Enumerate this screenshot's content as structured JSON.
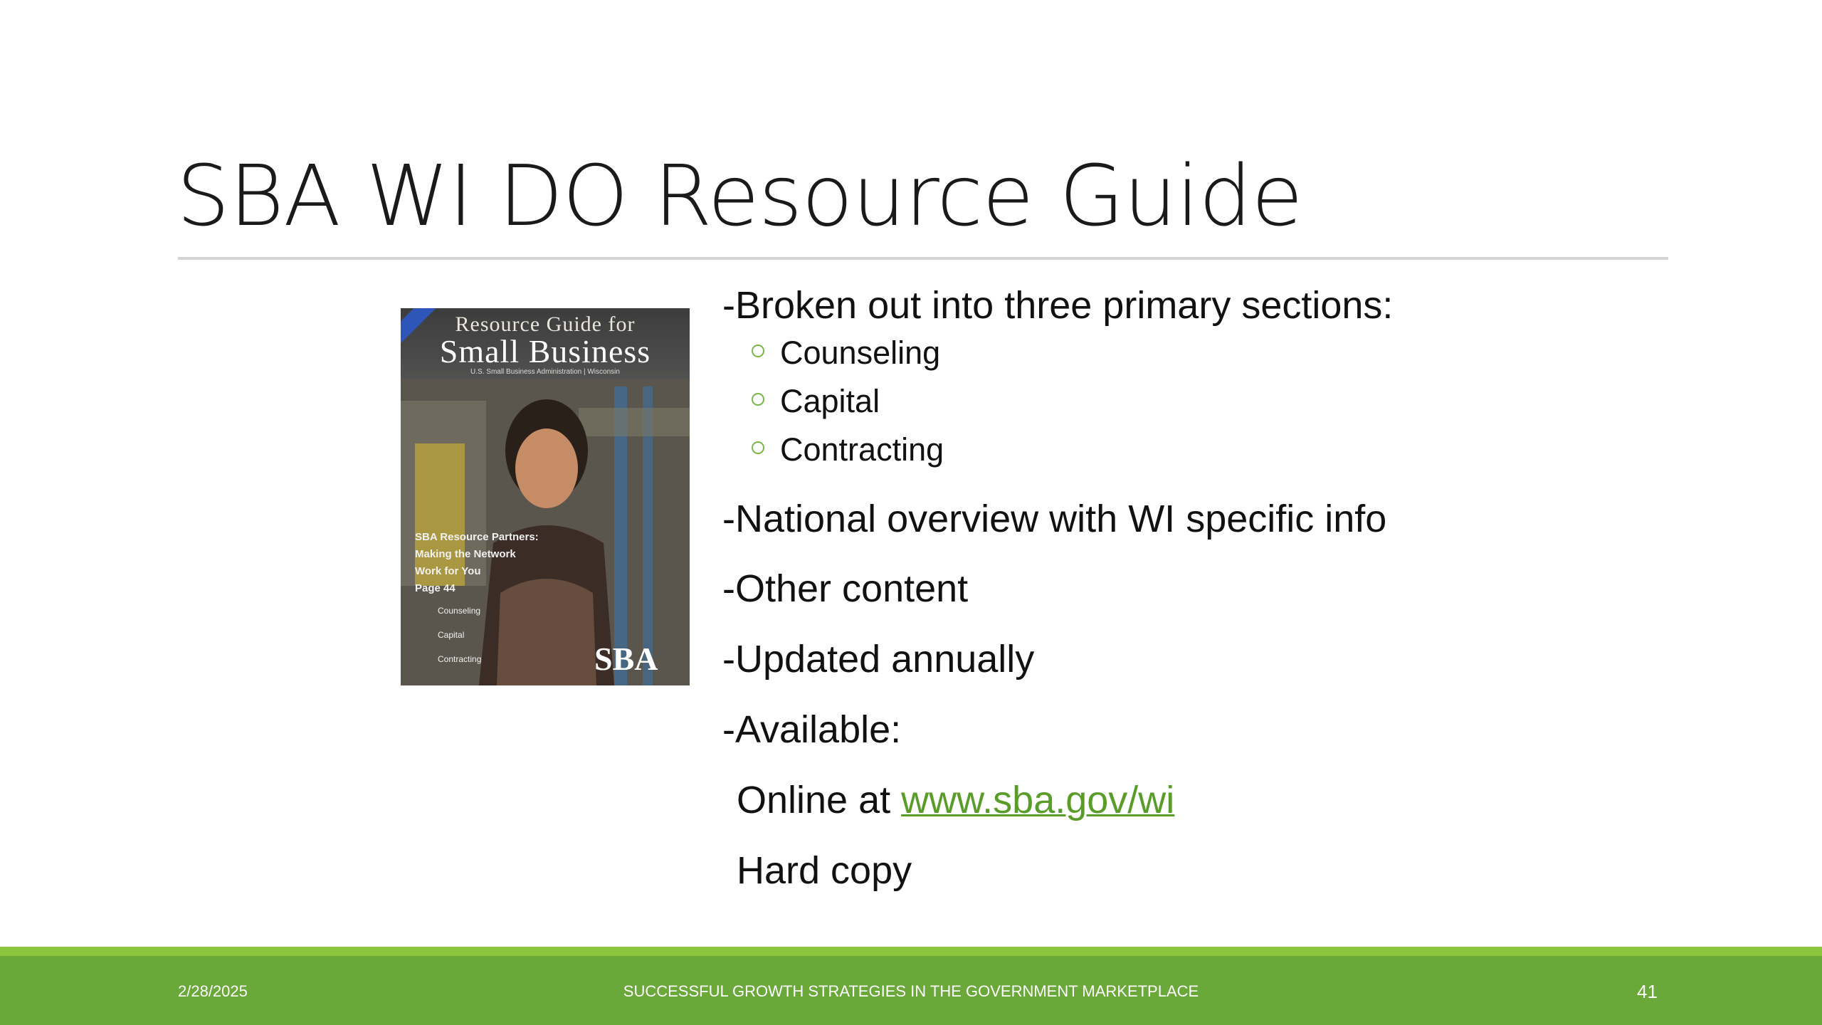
{
  "slide": {
    "title": "SBA WI DO Resource Guide",
    "cover": {
      "line1": "Resource Guide for",
      "line2": "Small Business",
      "line3": "U.S. Small Business Administration | Wisconsin",
      "teaser": [
        "SBA Resource Partners:",
        "Making the Network",
        "Work for You",
        "Page 44"
      ],
      "list": [
        "Counseling",
        "Capital",
        "Contracting"
      ],
      "logo": "SBA"
    },
    "bullets": {
      "p1": "-Broken out into three primary sections:",
      "sub": [
        "Counseling",
        "Capital",
        "Contracting"
      ],
      "p2": "-National overview with WI specific info",
      "p3": "-Other content",
      "p4": "-Updated annually",
      "p5": "-Available:",
      "p6_prefix": "Online at ",
      "p6_link": "www.sba.gov/wi",
      "p7": "Hard copy"
    },
    "footer": {
      "date": "2/28/2025",
      "center": "SUCCESSFUL GROWTH STRATEGIES IN THE GOVERNMENT MARKETPLACE",
      "page": "41"
    },
    "colors": {
      "accent_green": "#6aa83a",
      "accent_light_green": "#8cc63f",
      "link_green": "#5a9c2a"
    }
  }
}
